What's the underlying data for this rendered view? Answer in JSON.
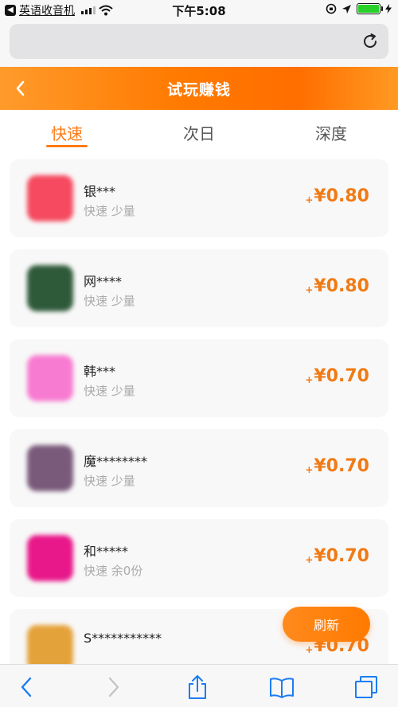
{
  "status_bar": {
    "back_app": "英语收音机",
    "time": "下午5:08"
  },
  "header": {
    "title": "试玩赚钱"
  },
  "tabs": [
    {
      "label": "快速",
      "active": true
    },
    {
      "label": "次日",
      "active": false
    },
    {
      "label": "深度",
      "active": false
    }
  ],
  "tasks": [
    {
      "name": "银***",
      "tags": "快速 少量",
      "reward_plus": "+",
      "reward": "¥0.80",
      "icon_color": "#f54a5f"
    },
    {
      "name": "网****",
      "tags": "快速 少量",
      "reward_plus": "+",
      "reward": "¥0.80",
      "icon_color": "#2f5a3a"
    },
    {
      "name": "韩***",
      "tags": "快速 少量",
      "reward_plus": "+",
      "reward": "¥0.70",
      "icon_color": "#f77bd1"
    },
    {
      "name": "魔********",
      "tags": "快速 少量",
      "reward_plus": "+",
      "reward": "¥0.70",
      "icon_color": "#7a5a7a"
    },
    {
      "name": "和*****",
      "tags": "快速 余0份",
      "reward_plus": "+",
      "reward": "¥0.70",
      "icon_color": "#e8188a"
    },
    {
      "name": "S***********",
      "tags": "",
      "reward_plus": "+",
      "reward": "¥0.70",
      "icon_color": "#e4a23a"
    }
  ],
  "refresh_button": {
    "label": "刷新"
  },
  "colors": {
    "accent": "#ff7b13",
    "reward": "#f07b16"
  }
}
